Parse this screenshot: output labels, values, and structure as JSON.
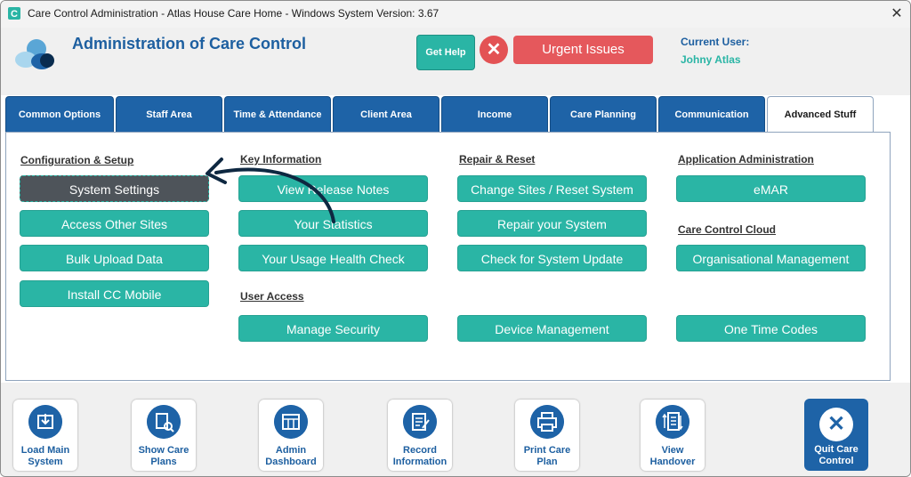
{
  "window": {
    "title": "Care Control Administration - Atlas House Care Home - Windows System Version: 3.67"
  },
  "header": {
    "app_title": "Administration of Care Control",
    "help_label": "Get Help",
    "urgent_label": "Urgent Issues",
    "user_label": "Current User:",
    "user_name": "Johny Atlas"
  },
  "tabs": [
    {
      "label": "Common Options"
    },
    {
      "label": "Staff Area"
    },
    {
      "label": "Time & Attendance"
    },
    {
      "label": "Client Area"
    },
    {
      "label": "Income"
    },
    {
      "label": "Care Planning"
    },
    {
      "label": "Communication"
    },
    {
      "label": "Advanced Stuff",
      "active": true
    }
  ],
  "sections": {
    "config": {
      "heading": "Configuration & Setup",
      "buttons": [
        "System Settings",
        "Access Other Sites",
        "Bulk Upload Data",
        "Install CC Mobile"
      ]
    },
    "key_info": {
      "heading": "Key Information",
      "buttons": [
        "View Release Notes",
        "Your Statistics",
        "Your Usage Health Check"
      ]
    },
    "user_access": {
      "heading": "User Access",
      "buttons": [
        "Manage Security"
      ]
    },
    "repair": {
      "heading": "Repair & Reset",
      "buttons": [
        "Change Sites / Reset System",
        "Repair your System",
        "Check for System Update",
        "Device Management"
      ]
    },
    "app_admin": {
      "heading": "Application Administration",
      "buttons": [
        "eMAR"
      ]
    },
    "cloud": {
      "heading": "Care Control Cloud",
      "buttons": [
        "Organisational Management",
        "One Time Codes"
      ]
    }
  },
  "bottom_bar": [
    {
      "label": "Load Main System",
      "icon": "load-icon"
    },
    {
      "label": "Show Care Plans",
      "icon": "care-plans-icon"
    },
    {
      "label": "Admin Dashboard",
      "icon": "dashboard-icon"
    },
    {
      "label": "Record Information",
      "icon": "record-icon"
    },
    {
      "label": "Print Care Plan",
      "icon": "printer-icon"
    },
    {
      "label": "View Handover",
      "icon": "handover-icon"
    }
  ],
  "quit": {
    "label": "Quit Care Control"
  },
  "colors": {
    "teal": "#2ab5a5",
    "blue": "#1e63a7",
    "red": "#e5585c",
    "dark": "#4e545a"
  }
}
